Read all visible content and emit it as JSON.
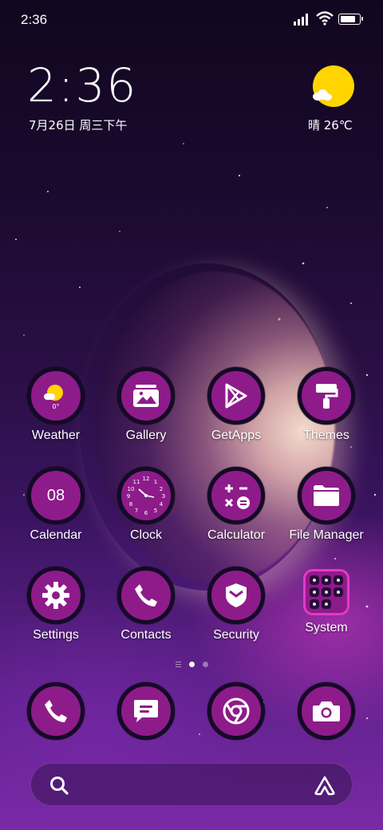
{
  "status_bar": {
    "time": "2:36",
    "signal_icon": "signal-icon",
    "wifi_icon": "wifi-icon",
    "battery_icon": "battery-icon",
    "battery_level": 0.85
  },
  "clock_widget": {
    "time": "2:36",
    "date": "7月26日 周三下午"
  },
  "weather_widget": {
    "text": "晴 26℃",
    "icon": "sunny-partly-cloudy-icon"
  },
  "apps": [
    {
      "label": "Weather",
      "icon": "weather-icon",
      "badge": "0°"
    },
    {
      "label": "Gallery",
      "icon": "gallery-icon"
    },
    {
      "label": "GetApps",
      "icon": "play-store-icon"
    },
    {
      "label": "Themes",
      "icon": "paint-roller-icon"
    },
    {
      "label": "Calendar",
      "icon": "calendar-icon",
      "day": "08"
    },
    {
      "label": "Clock",
      "icon": "clock-icon"
    },
    {
      "label": "Calculator",
      "icon": "calculator-icon"
    },
    {
      "label": "File Manager",
      "icon": "folder-icon"
    },
    {
      "label": "Settings",
      "icon": "gear-icon"
    },
    {
      "label": "Contacts",
      "icon": "phone-icon"
    },
    {
      "label": "Security",
      "icon": "shield-icon"
    },
    {
      "label": "System",
      "icon": "app-folder-icon"
    }
  ],
  "dock": [
    {
      "icon": "phone-icon"
    },
    {
      "icon": "messages-icon"
    },
    {
      "icon": "chrome-icon"
    },
    {
      "icon": "camera-icon"
    }
  ],
  "pager": {
    "pages": 2,
    "active": 1
  },
  "search_bar": {
    "search_icon": "search-icon",
    "assistant_icon": "assistant-icon"
  },
  "colors": {
    "icon_fill": "#8e1b8a",
    "icon_ring": "#140a26",
    "folder_border": "#e23ac8",
    "sun": "#ffd400"
  }
}
